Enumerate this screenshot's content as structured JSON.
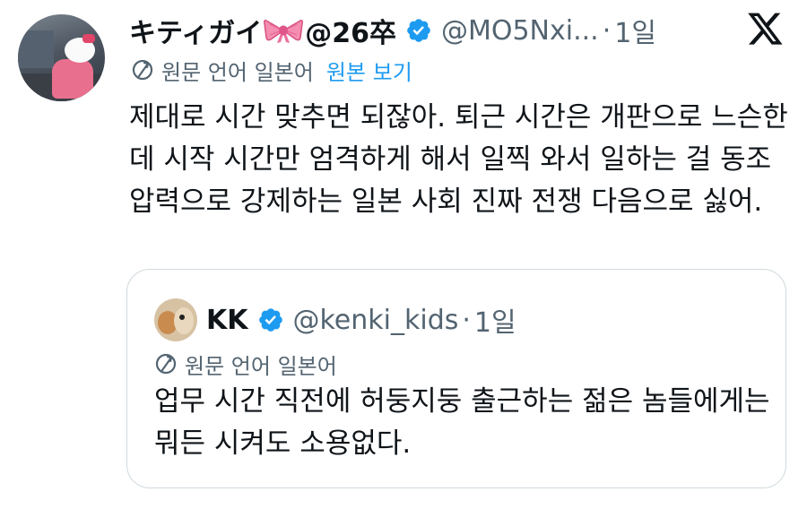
{
  "tweet": {
    "display_name": "キティガイ",
    "name_suffix": "@26卒",
    "handle": "@MO5Nxi...",
    "separator": "·",
    "time": "1일",
    "translation_label": "원문 언어 일본어",
    "show_original": "원본 보기",
    "text": "제대로 시간 맞추면 되잖아. 퇴근 시간은 개판으로 느슨한데 시작 시간만 엄격하게 해서 일찍 와서 일하는 걸 동조 압력으로 강제하는 일본 사회 진짜 전쟁 다음으로 싫어."
  },
  "quote": {
    "display_name": "KK",
    "handle": "@kenki_kids",
    "separator": "·",
    "time": "1일",
    "translation_label": "원문 언어 일본어",
    "text": "업무 시간 직전에 허둥지둥 출근하는 젊은 놈들에게는 뭐든 시켜도 소용없다."
  },
  "icons": {
    "verified": "verified-badge-icon",
    "platform": "x-logo-icon",
    "translate": "translate-icon",
    "emoji": "ribbon-bow-emoji"
  },
  "colors": {
    "accent": "#1d9bf0",
    "secondary_text": "#536471",
    "border": "#cfd9de",
    "bow": "#f06a9a"
  }
}
